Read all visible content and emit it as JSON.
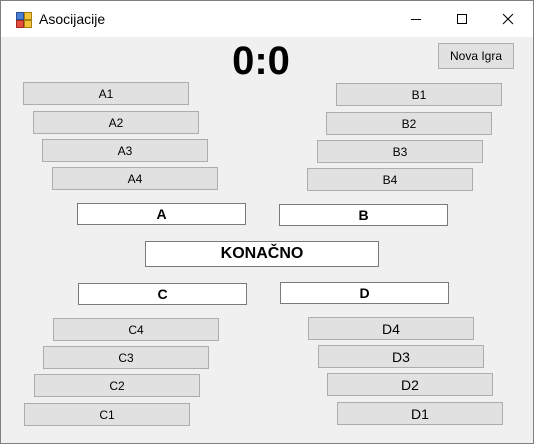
{
  "window": {
    "title": "Asocijacije"
  },
  "score": "0:0",
  "new_game_label": "Nova Igra",
  "columns": {
    "A": {
      "cells": [
        "A1",
        "A2",
        "A3",
        "A4"
      ],
      "answer": "A"
    },
    "B": {
      "cells": [
        "B1",
        "B2",
        "B3",
        "B4"
      ],
      "answer": "B"
    },
    "C": {
      "cells": [
        "C4",
        "C3",
        "C2",
        "C1"
      ],
      "answer": "C"
    },
    "D": {
      "cells": [
        "D4",
        "D3",
        "D2",
        "D1"
      ],
      "answer": "D"
    }
  },
  "final_answer": "KONAČNO"
}
